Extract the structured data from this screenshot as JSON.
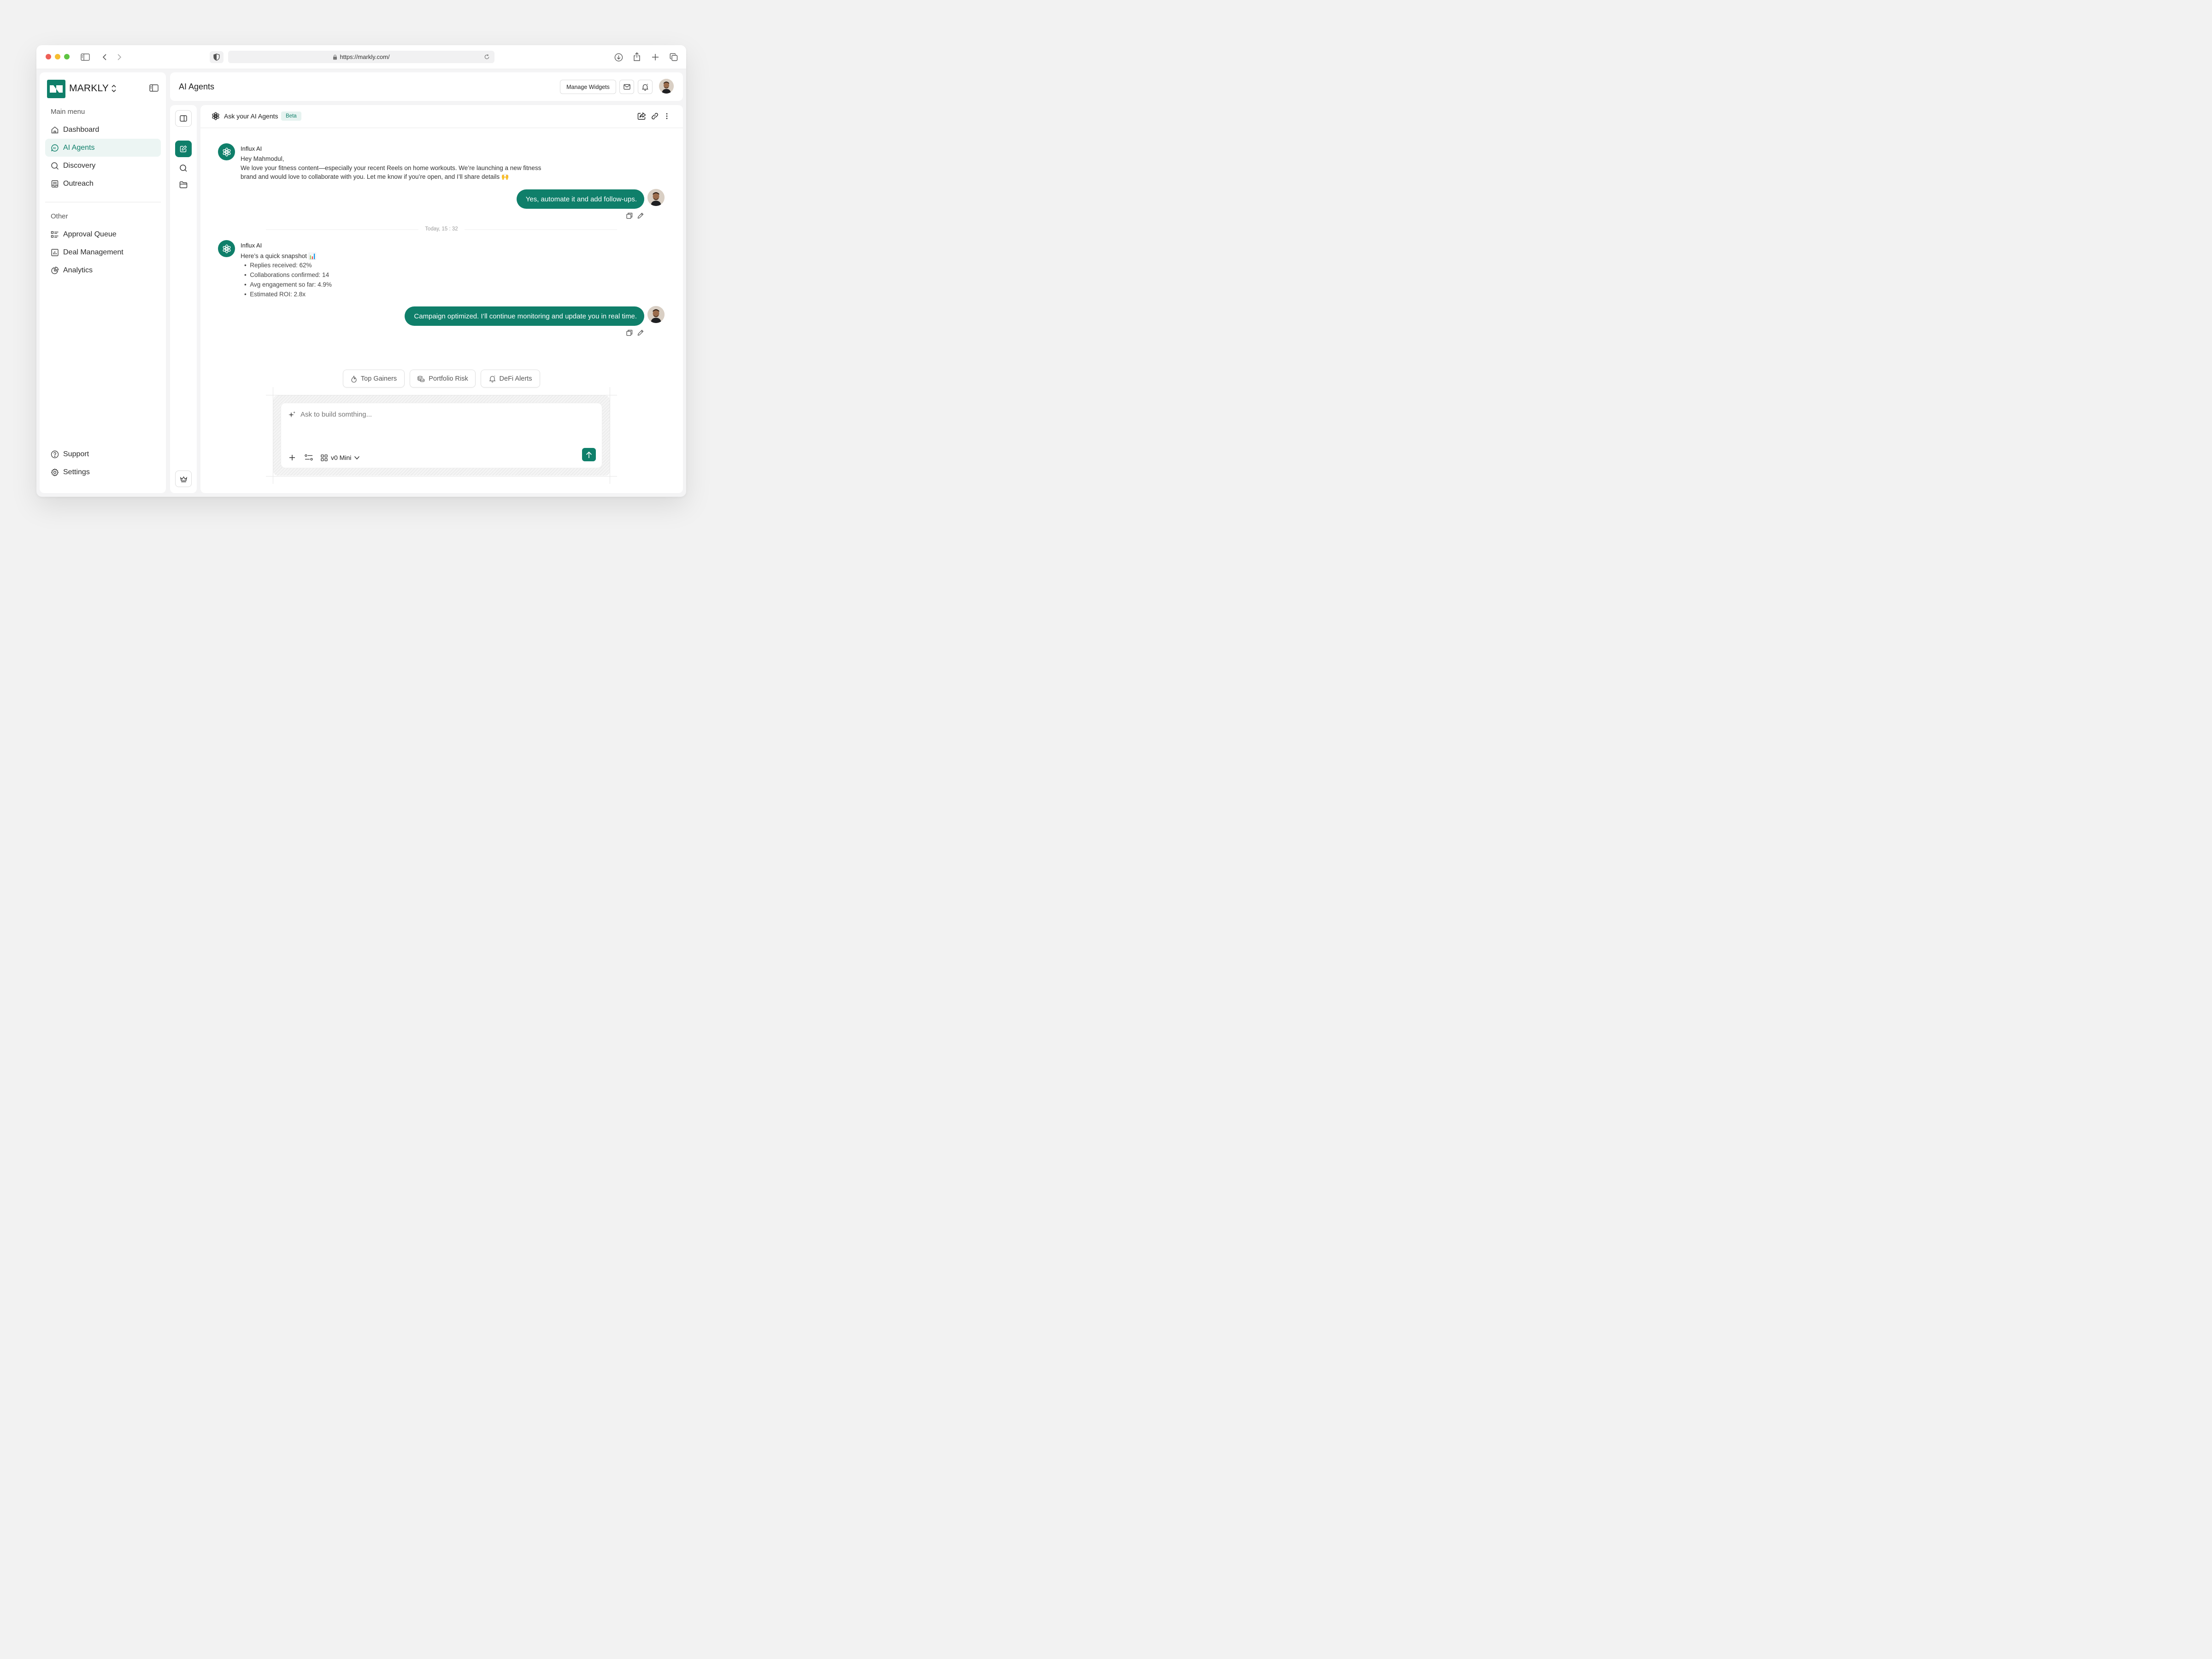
{
  "browser": {
    "url": "https://markly.com/"
  },
  "sidebar": {
    "brand": "MARKLY",
    "main_menu_label": "Main menu",
    "main_items": [
      {
        "label": "Dashboard",
        "icon": "home-icon"
      },
      {
        "label": "AI Agents",
        "icon": "ai-chat-icon",
        "active": true
      },
      {
        "label": "Discovery",
        "icon": "search-icon"
      },
      {
        "label": "Outreach",
        "icon": "outreach-icon"
      }
    ],
    "other_label": "Other",
    "other_items": [
      {
        "label": "Approval Queue",
        "icon": "list-icon"
      },
      {
        "label": "Deal Management",
        "icon": "chart-box-icon"
      },
      {
        "label": "Analytics",
        "icon": "pie-icon"
      }
    ],
    "bottom_items": [
      {
        "label": "Support",
        "icon": "help-icon"
      },
      {
        "label": "Settings",
        "icon": "gear-icon"
      }
    ]
  },
  "header": {
    "title": "AI Agents",
    "manage_widgets_label": "Manage Widgets"
  },
  "chat": {
    "title": "Ask your AI Agents",
    "badge": "Beta",
    "messages": [
      {
        "sender": "Influx AI",
        "lines": [
          "Hey Mahmodul,",
          "We love your fitness content—especially your recent Reels on home workouts. We’re launching a new fitness",
          "brand and would love to collaborate with you. Let me know if you’re open, and I’ll share details 🙌"
        ]
      },
      {
        "sender": "user",
        "text": "Yes, automate it and add follow-ups."
      },
      {
        "divider": "Today, 15 : 32"
      },
      {
        "sender": "Influx AI",
        "intro": "Here’s a quick snapshot 📊",
        "bullets": [
          "Replies received: 62%",
          "Collaborations confirmed: 14",
          "Avg engagement so far: 4.9%",
          "Estimated ROI: 2.8x"
        ]
      },
      {
        "sender": "user",
        "text": "Campaign optimized. I’ll continue monitoring and update you in real time."
      }
    ],
    "suggestions": [
      "Top Gainers",
      "Portfolio Risk",
      "DeFi Alerts"
    ],
    "composer": {
      "placeholder": "Ask to build somthing...",
      "model": "v0 Mini"
    }
  },
  "colors": {
    "accent": "#0f7f6a",
    "active_bg": "#ecf5f3"
  }
}
